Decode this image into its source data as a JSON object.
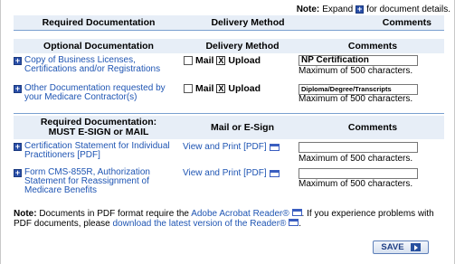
{
  "note_top": {
    "label": "Note:",
    "text_before": "Expand",
    "text_after": "for document details."
  },
  "required_header": {
    "col1": "Required Documentation",
    "col2": "Delivery Method",
    "col3": "Comments"
  },
  "optional_header": {
    "col1": "Optional Documentation",
    "col2": "Delivery Method",
    "col3": "Comments"
  },
  "optional_rows": [
    {
      "label": "Copy of Business Licenses, Certifications and/or Registrations",
      "mail": "Mail",
      "upload": "Upload",
      "upload_checked": "X",
      "comment_value": "NP Certification",
      "max": "Maximum of 500 characters."
    },
    {
      "label": "Other Documentation requested by your Medicare Contractor(s)",
      "mail": "Mail",
      "upload": "Upload",
      "upload_checked": "X",
      "comment_value": "Diploma/Degree/Transcripts",
      "max": "Maximum of 500 characters."
    }
  ],
  "esign_header": {
    "col1_line1": "Required Documentation:",
    "col1_line2": "MUST E-SIGN or MAIL",
    "col2": "Mail or E-Sign",
    "col3": "Comments"
  },
  "esign_rows": [
    {
      "label": "Certification Statement for Individual Practitioners [PDF]",
      "view": "View and Print [PDF]",
      "comment_value": "",
      "max": "Maximum of 500 characters."
    },
    {
      "label": "Form CMS-855R, Authorization Statement for Reassignment of Medicare Benefits",
      "view": "View and Print [PDF]",
      "comment_value": "",
      "max": "Maximum of 500 characters."
    }
  ],
  "bottom_note": {
    "label": "Note:",
    "text1": "Documents in PDF format require the",
    "link1": "Adobe Acrobat Reader®",
    "text2": ". If you experience problems with PDF documents, please",
    "link2": "download the latest version of the Reader®",
    "text3": "."
  },
  "save_label": "SAVE",
  "colors": {
    "header_bg": "#e7eef7",
    "link": "#1f55b3",
    "icon_blue": "#2a4fa8"
  }
}
